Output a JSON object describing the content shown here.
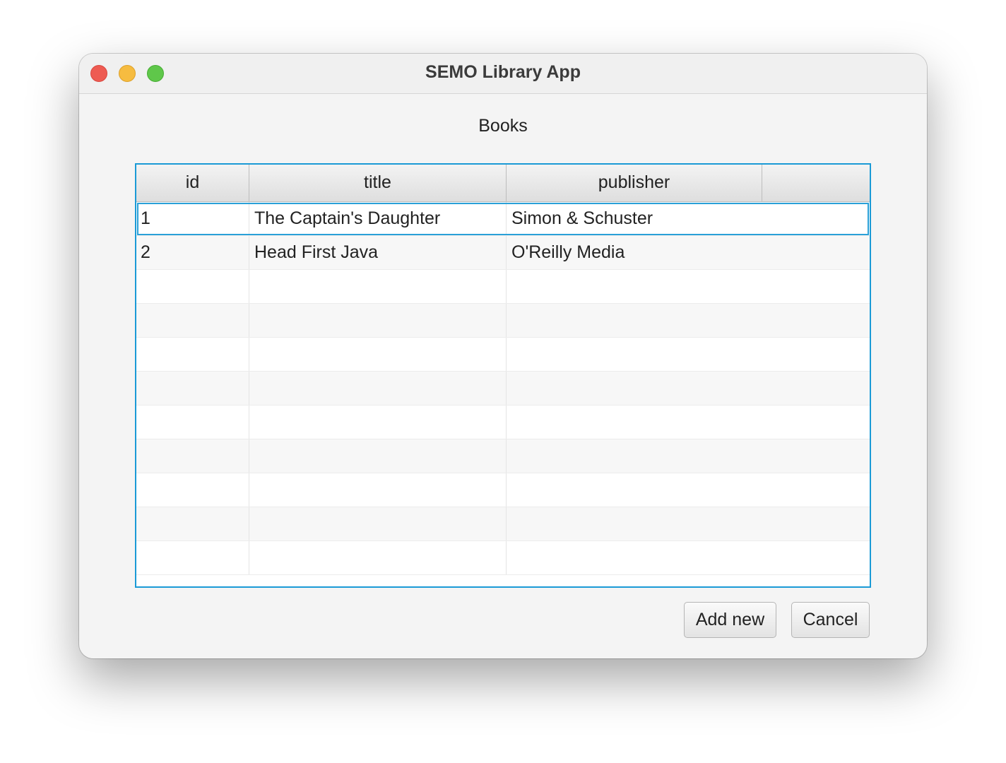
{
  "window": {
    "title": "SEMO Library App"
  },
  "section": {
    "label": "Books"
  },
  "table": {
    "columns": [
      "id",
      "title",
      "publisher",
      ""
    ],
    "rows": [
      {
        "id": "1",
        "title": "The Captain's Daughter",
        "publisher": "Simon & Schuster"
      },
      {
        "id": "2",
        "title": "Head First Java",
        "publisher": "O'Reilly Media"
      }
    ],
    "selected_row": 0
  },
  "buttons": {
    "add_label": "Add new",
    "cancel_label": "Cancel"
  },
  "colors": {
    "selection": "#1a9ad6",
    "close": "#ee5b52",
    "minimize": "#f6bc40",
    "maximize": "#5fc74a"
  }
}
